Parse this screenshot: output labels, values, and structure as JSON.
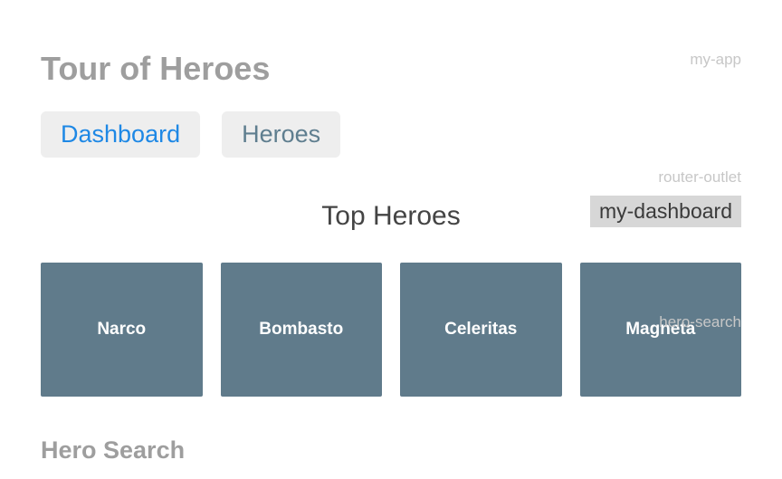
{
  "app": {
    "title": "Tour of Heroes"
  },
  "nav": {
    "items": [
      {
        "label": "Dashboard",
        "active": true
      },
      {
        "label": "Heroes",
        "active": false
      }
    ]
  },
  "dashboard": {
    "heading": "Top Heroes",
    "heroes": [
      {
        "name": "Narco"
      },
      {
        "name": "Bombasto"
      },
      {
        "name": "Celeritas"
      },
      {
        "name": "Magneta"
      }
    ]
  },
  "search": {
    "heading": "Hero Search"
  },
  "dev_labels": {
    "my_app": "my-app",
    "router_outlet": "router-outlet",
    "my_dashboard": "my-dashboard",
    "hero_search": "hero-search"
  }
}
